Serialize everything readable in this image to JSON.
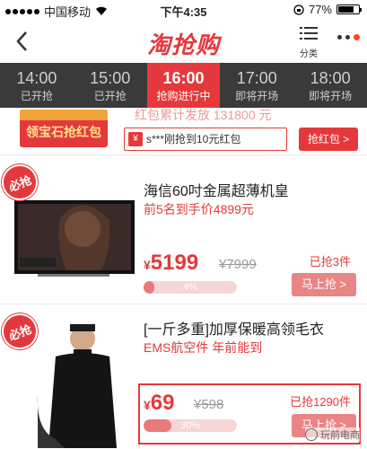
{
  "status_bar": {
    "carrier": "中国移动",
    "time": "下午4:35",
    "battery": "77%",
    "battery_level": 0.77
  },
  "header": {
    "title": "淘抢购",
    "category_label": "分类"
  },
  "time_tabs": [
    {
      "time": "14:00",
      "status": "已开抢",
      "active": false
    },
    {
      "time": "15:00",
      "status": "已开抢",
      "active": false
    },
    {
      "time": "16:00",
      "status": "抢购进行中",
      "active": true
    },
    {
      "time": "17:00",
      "status": "即将开场",
      "active": false
    },
    {
      "time": "18:00",
      "status": "即将开场",
      "active": false
    }
  ],
  "envelope": {
    "ghost_text": "红包累计发放 131800 元",
    "button_label": "领宝石抢红包",
    "notice": "s***刚抢到10元红包",
    "grab_label": "抢红包 >"
  },
  "products": [
    {
      "badge": "必抢",
      "title": "海信60吋金属超薄机皇",
      "subtitle": "前5名到手价4899元",
      "currency": "¥",
      "price": "5199",
      "original_price": "¥7999",
      "sold": "已抢3件",
      "progress_label": "4%",
      "progress": 0.04,
      "buy_label": "马上抢 >"
    },
    {
      "badge": "必抢",
      "title": "[一斤多重]加厚保暖高领毛衣",
      "subtitle": "EMS航空件 年前能到",
      "currency": "¥",
      "price": "69",
      "original_price": "¥598",
      "sold": "已抢1290件",
      "progress_label": "30%",
      "progress": 0.3,
      "buy_label": "马上抢 >"
    }
  ],
  "watermark": "玩前电商",
  "colors": {
    "brand": "#e4393c",
    "tab_bg": "#3a3a3a"
  }
}
